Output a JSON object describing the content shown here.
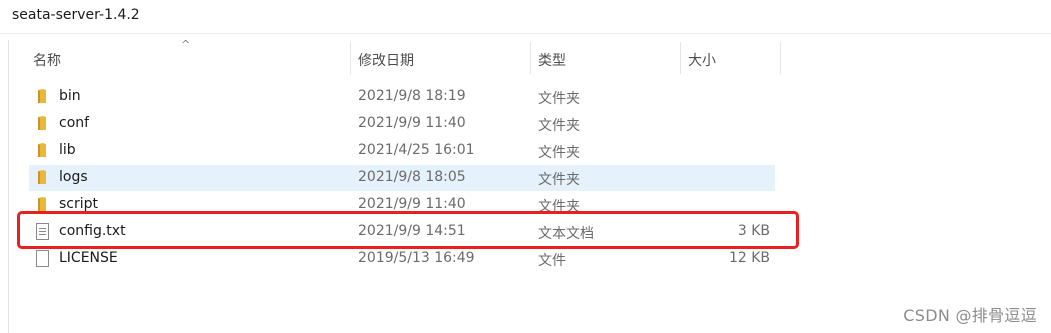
{
  "path": {
    "label": "seata-server-1.4.2"
  },
  "columns": {
    "name": "名称",
    "date": "修改日期",
    "type": "类型",
    "size": "大小"
  },
  "files": [
    {
      "name": "bin",
      "date": "2021/9/8 18:19",
      "type": "文件夹",
      "size": "",
      "icon": "folder-icon",
      "selected": false
    },
    {
      "name": "conf",
      "date": "2021/9/9 11:40",
      "type": "文件夹",
      "size": "",
      "icon": "folder-icon",
      "selected": false
    },
    {
      "name": "lib",
      "date": "2021/4/25 16:01",
      "type": "文件夹",
      "size": "",
      "icon": "folder-icon",
      "selected": false
    },
    {
      "name": "logs",
      "date": "2021/9/8 18:05",
      "type": "文件夹",
      "size": "",
      "icon": "folder-icon",
      "selected": true
    },
    {
      "name": "script",
      "date": "2021/9/9 11:40",
      "type": "文件夹",
      "size": "",
      "icon": "folder-icon",
      "selected": false
    },
    {
      "name": "config.txt",
      "date": "2021/9/9 14:51",
      "type": "文本文档",
      "size": "3 KB",
      "icon": "text-file-icon",
      "selected": false
    },
    {
      "name": "LICENSE",
      "date": "2019/5/13 16:49",
      "type": "文件",
      "size": "12 KB",
      "icon": "file-icon",
      "selected": false
    }
  ],
  "watermark": "CSDN @排骨逗逗",
  "colors": {
    "selection": "#e5f1fb",
    "highlight": "#e8201f",
    "folder": "#e8b83a"
  }
}
